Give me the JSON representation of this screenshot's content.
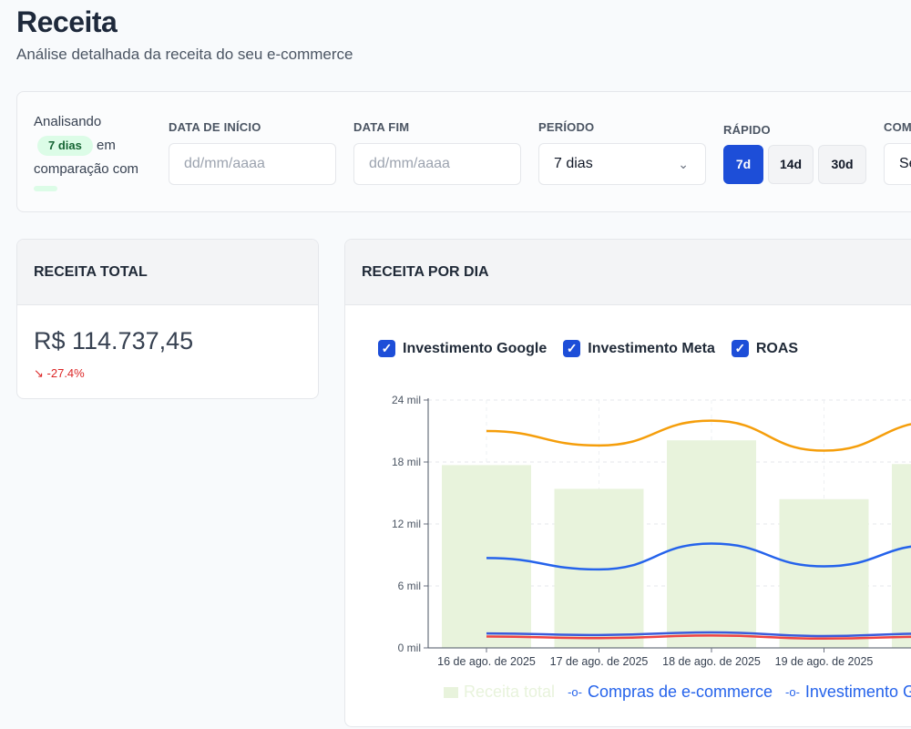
{
  "header": {
    "title": "Receita",
    "subtitle": "Análise detalhada da receita do seu e-commerce"
  },
  "filters": {
    "analyzing_prefix": "Analisando",
    "days_pill": "7 dias",
    "analyzing_mid": "em",
    "analyzing_suffix": "comparação com",
    "start_label": "DATA DE INÍCIO",
    "start_placeholder": "dd/mm/aaaa",
    "end_label": "DATA FIM",
    "end_placeholder": "dd/mm/aaaa",
    "period_label": "PERÍODO",
    "period_value": "7 dias",
    "quick_label": "RÁPIDO",
    "quick_buttons": [
      "7d",
      "14d",
      "30d"
    ],
    "quick_active": "7d",
    "compare_label": "COM",
    "compare_value": "Se"
  },
  "kpi": {
    "title": "RECEITA TOTAL",
    "value": "R$ 114.737,45",
    "delta": "-27.4%",
    "delta_icon": "trend-down-icon",
    "delta_color": "#dc2626"
  },
  "revenue_chart": {
    "title": "RECEITA POR DIA",
    "toggles": [
      {
        "label": "Investimento Google",
        "checked": true
      },
      {
        "label": "Investimento Meta",
        "checked": true
      },
      {
        "label": "ROAS",
        "checked": true
      }
    ],
    "legend": [
      {
        "label": "Receita total",
        "color": "#e8f3dc"
      },
      {
        "label": "Compras de e-commerce",
        "color": "#2563eb"
      },
      {
        "label": "Investimento G",
        "color": "#2563eb"
      }
    ]
  },
  "chart_data": {
    "type": "bar",
    "categories": [
      "16 de ago. de 2025",
      "17 de ago. de 2025",
      "18 de ago. de 2025",
      "19 de ago. de 2025",
      "20 de"
    ],
    "yticks": [
      "0 mil",
      "6 mil",
      "12 mil",
      "18 mil",
      "24 mil"
    ],
    "ylim": [
      0,
      24000
    ],
    "grid": true,
    "series": [
      {
        "name": "Receita total",
        "kind": "bar",
        "color": "#e8f3dc",
        "values": [
          17700,
          15400,
          20100,
          14400,
          17800
        ]
      },
      {
        "name": "Compras de e-commerce",
        "kind": "line",
        "color": "#2563eb",
        "values": [
          8700,
          7600,
          10100,
          7900,
          10000
        ]
      },
      {
        "kind": "line",
        "color": "#f59e0b",
        "values": [
          21000,
          19600,
          22000,
          19100,
          21900
        ]
      },
      {
        "kind": "line",
        "color": "#3b5bdb",
        "values": [
          1400,
          1250,
          1500,
          1150,
          1400
        ]
      },
      {
        "kind": "line",
        "color": "#ef4444",
        "values": [
          1100,
          950,
          1200,
          900,
          1100
        ]
      }
    ]
  }
}
